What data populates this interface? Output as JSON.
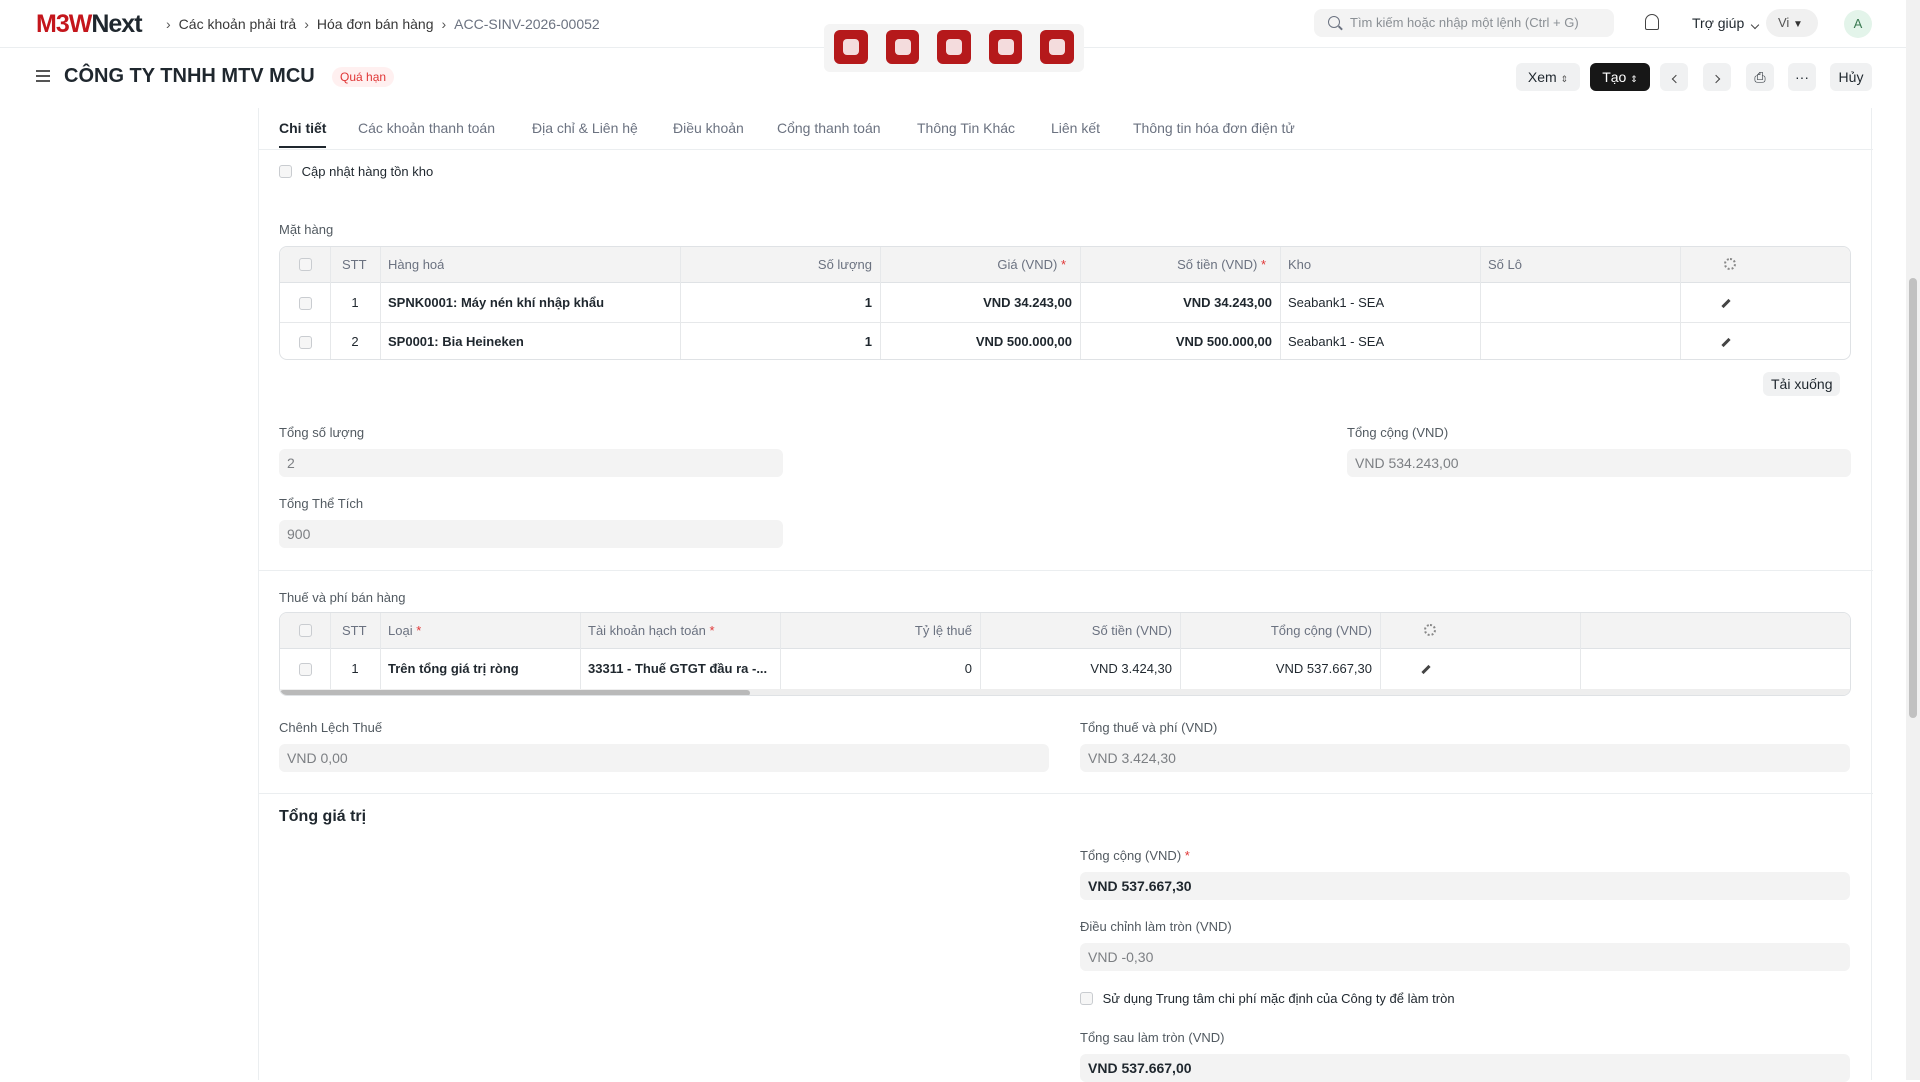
{
  "brand": {
    "part1": "M3W",
    "part2": "Next"
  },
  "breadcrumb": {
    "items": [
      "Các khoản phải trả",
      "Hóa đơn bán hàng",
      "ACC-SINV-2026-00052"
    ]
  },
  "search": {
    "placeholder": "Tìm kiếm hoặc nhập một lệnh (Ctrl + G)"
  },
  "nav": {
    "help": "Trợ giúp",
    "lang": "Vi",
    "avatar": "A"
  },
  "toolbar_icons": [
    "red-app-icon-1",
    "red-app-icon-2",
    "red-app-icon-3",
    "red-app-icon-4",
    "red-app-icon-5"
  ],
  "page": {
    "title": "CÔNG TY TNHH MTV MCU",
    "status": "Quá hạn",
    "buttons": {
      "view": "Xem",
      "create": "Tạo",
      "cancel": "Hủy",
      "more": "···"
    }
  },
  "tabs": [
    "Chi tiết",
    "Các khoản thanh toán",
    "Địa chỉ & Liên hệ",
    "Điều khoản",
    "Cổng thanh toán",
    "Thông Tin Khác",
    "Liên kết",
    "Thông tin hóa đơn điện tử"
  ],
  "update_stock_label": "Cập nhật hàng tồn kho",
  "items": {
    "section_label": "Mặt hàng",
    "headers": {
      "no": "STT",
      "item": "Hàng hoá",
      "qty": "Số lượng",
      "rate": "Giá (VND)",
      "amount": "Số tiền (VND)",
      "warehouse": "Kho",
      "batch": "Số Lô"
    },
    "rows": [
      {
        "no": "1",
        "item": "SPNK0001: Máy nén khí nhập khẩu",
        "qty": "1",
        "rate": "VND 34.243,00",
        "amount": "VND 34.243,00",
        "warehouse": "Seabank1 - SEA",
        "batch": ""
      },
      {
        "no": "2",
        "item": "SP0001: Bia Heineken",
        "qty": "1",
        "rate": "VND 500.000,00",
        "amount": "VND 500.000,00",
        "warehouse": "Seabank1 - SEA",
        "batch": ""
      }
    ],
    "download": "Tải xuống"
  },
  "totals": {
    "total_qty_label": "Tổng số lượng",
    "total_qty": "2",
    "total_label": "Tổng cộng (VND)",
    "total": "VND 534.243,00",
    "total_volume_label": "Tổng Thể Tích",
    "total_volume": "900"
  },
  "taxes": {
    "section_label": "Thuế và phí bán hàng",
    "headers": {
      "no": "STT",
      "type": "Loại",
      "account": "Tài khoản hạch toán",
      "rate": "Tỷ lệ thuế",
      "amount": "Số tiền (VND)",
      "total": "Tổng cộng (VND)"
    },
    "rows": [
      {
        "no": "1",
        "type": "Trên tổng giá trị ròng",
        "account": "33311 - Thuế GTGT đầu ra -...",
        "rate": "0",
        "amount": "VND 3.424,30",
        "total": "VND 537.667,30"
      }
    ],
    "diff_label": "Chênh Lệch Thuế",
    "diff": "VND 0,00",
    "total_tax_label": "Tổng thuế và phí (VND)",
    "total_tax": "VND 3.424,30"
  },
  "grand": {
    "section_title": "Tổng giá trị",
    "grand_total_label": "Tổng cộng (VND)",
    "grand_total": "VND 537.667,30",
    "rounding_label": "Điều chỉnh làm tròn (VND)",
    "rounding": "VND -0,30",
    "use_cost_center_label": "Sử dụng Trung tâm chi phí mặc định của Công ty để làm tròn",
    "rounded_total_label": "Tổng sau làm tròn (VND)",
    "rounded_total": "VND 537.667,00"
  }
}
